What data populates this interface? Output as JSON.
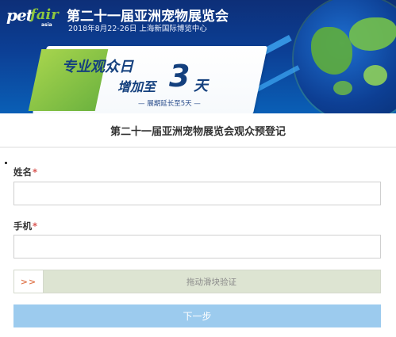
{
  "banner": {
    "logo": {
      "pet": "pet",
      "fair": "fair",
      "asia": "asia"
    },
    "title": "第二十一届亚洲宠物展览会",
    "subtitle": "2018年8月22-26日 上海新国际博览中心",
    "promo": {
      "line1": "专业观众日",
      "line2": "增加至",
      "big_number": "3",
      "unit": "天",
      "note": "— 展期延长至5天 —"
    }
  },
  "form": {
    "title": "第二十一届亚洲宠物展览会观众预登记",
    "name": {
      "label": "姓名",
      "required_mark": "*",
      "value": "",
      "placeholder": ""
    },
    "phone": {
      "label": "手机",
      "required_mark": "*",
      "value": "",
      "placeholder": ""
    },
    "slider": {
      "handle_text": ">>",
      "text": "拖动滑块验证"
    },
    "next_button": "下一步"
  },
  "colors": {
    "banner_bg": "#0c3f95",
    "promo_text": "#14407e",
    "accent_green": "#8ec63f",
    "required": "#d9534f",
    "slider_bg": "#dde4d2",
    "slider_arrow": "#e07b53",
    "button_bg": "#9ccbee"
  }
}
